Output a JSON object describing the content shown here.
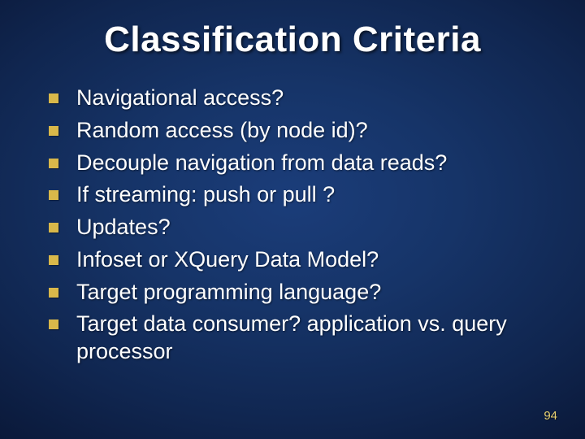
{
  "title": "Classification Criteria",
  "bullets": [
    "Navigational access?",
    "Random access (by node id)?",
    "Decouple navigation from data reads?",
    "If streaming: push or pull ?",
    "Updates?",
    "Infoset or XQuery Data Model?",
    "Target programming language?",
    "Target data consumer? application vs. query processor"
  ],
  "page_number": "94"
}
